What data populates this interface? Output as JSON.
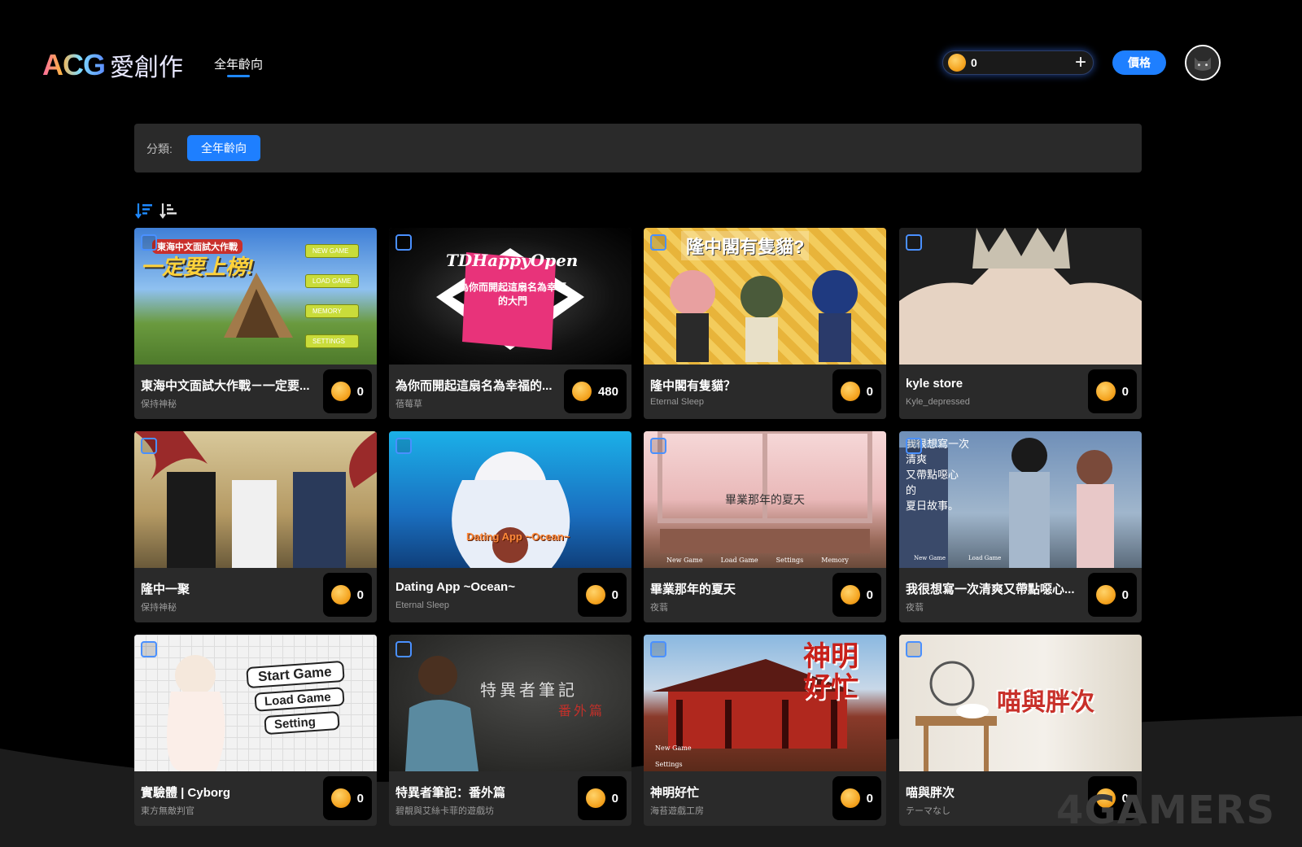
{
  "header": {
    "logo_acg": "ACG",
    "logo_cn": "愛創作",
    "nav_tab": "全年齡向",
    "coin_count": "0",
    "coin_plus": "+",
    "price_button": "價格"
  },
  "category": {
    "label": "分類:",
    "chip": "全年齡向"
  },
  "cards": [
    {
      "title": "東海中文面試大作戰－一定要...",
      "author": "保持神秘",
      "price": "0",
      "thumb_text": "一定要上榜!",
      "thumb_sub": "東海中文面試大作戰",
      "menu": [
        "NEW GAME",
        "LOAD GAME",
        "MEMORY",
        "SETTINGS"
      ]
    },
    {
      "title": "為你而開起這扇名為幸福的...",
      "author": "蓓莓草",
      "price": "480",
      "thumb_text": "TDHappyOpen",
      "thumb_sub": "為你而開起這扇名為幸福的大門"
    },
    {
      "title": "隆中閣有隻貓？",
      "author": "Eternal Sleep",
      "price": "0",
      "thumb_text": "隆中閣有隻貓?"
    },
    {
      "title": "kyle store",
      "author": "Kyle_depressed",
      "price": "0"
    },
    {
      "title": "隆中一聚",
      "author": "保持神秘",
      "price": "0"
    },
    {
      "title": "Dating App ~Ocean~",
      "author": "Eternal Sleep",
      "price": "0",
      "thumb_text": "Dating App ~Ocean~"
    },
    {
      "title": "畢業那年的夏天",
      "author": "夜蓊",
      "price": "0",
      "thumb_text": "畢業那年的夏天",
      "menu": [
        "New Game",
        "Load Game",
        "Settings",
        "Memory"
      ]
    },
    {
      "title": "我很想寫一次清爽又帶點噁心...",
      "author": "夜蓊",
      "price": "0",
      "thumb_lines": [
        "我很想寫一次",
        "清爽",
        "又帶點噁心",
        "的",
        "夏日故事。"
      ],
      "menu": [
        "New Game",
        "Load Game"
      ]
    },
    {
      "title": "實驗體 | Cyborg",
      "author": "東方無敵判官",
      "price": "0",
      "menu": [
        "Start Game",
        "Load Game",
        "Setting"
      ]
    },
    {
      "title": "特異者筆記：番外篇",
      "author": "碧靚與艾絲卡菲的遊戲坊",
      "price": "0",
      "thumb_text": "特異者筆記",
      "thumb_sub": "番外篇"
    },
    {
      "title": "神明好忙",
      "author": "海苔遊戲工房",
      "price": "0",
      "thumb_text": "神明好忙",
      "menu": [
        "New Game",
        "Settings"
      ]
    },
    {
      "title": "喵與胖次",
      "author": "テーマなし",
      "price": "0",
      "thumb_text": "喵與胖次"
    }
  ],
  "watermark": "4GAMERS"
}
